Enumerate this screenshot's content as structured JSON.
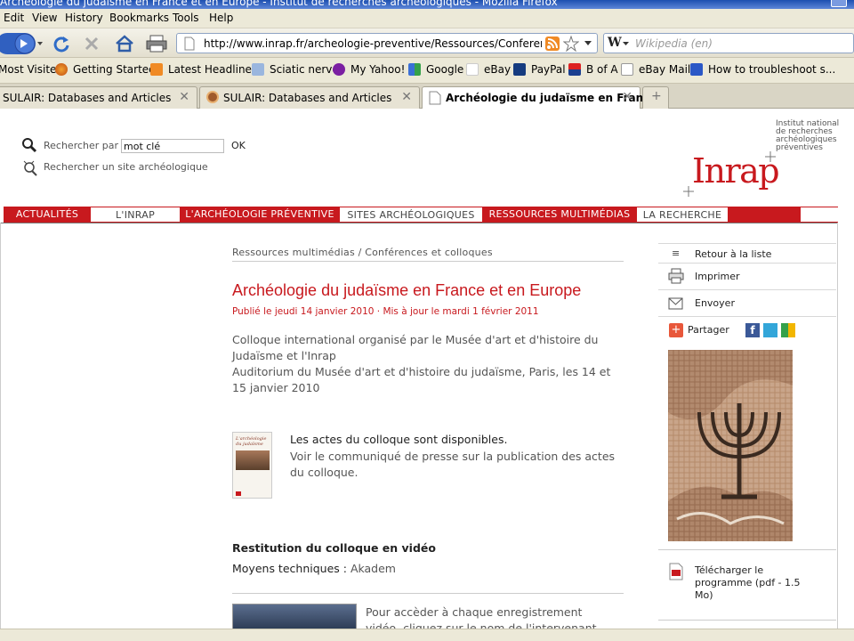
{
  "window": {
    "title": "Archéologie du judaïsme en France et en Europe - Institut de recherches archéologiques - Mozilla Firefox"
  },
  "menu": {
    "items": [
      "Edit",
      "View",
      "History",
      "Bookmarks",
      "Tools",
      "Help"
    ]
  },
  "nav": {
    "url": "http://www.inrap.fr/archeologie-preventive/Ressources/Conferences-et",
    "search_placeholder": "Wikipedia (en)"
  },
  "bookmarks": [
    {
      "label": "Most Visited",
      "icon": "folder-icon"
    },
    {
      "label": "Getting Started",
      "icon": "firefox-icon"
    },
    {
      "label": "Latest Headlines",
      "icon": "rss-icon"
    },
    {
      "label": "Sciatic nerve",
      "icon": "page-icon"
    },
    {
      "label": "My Yahoo!",
      "icon": "yahoo-icon"
    },
    {
      "label": "Google",
      "icon": "google-icon"
    },
    {
      "label": "eBay",
      "icon": "ebay-icon"
    },
    {
      "label": "PayPal",
      "icon": "paypal-icon"
    },
    {
      "label": "B of A",
      "icon": "bofa-icon"
    },
    {
      "label": "eBay Mail",
      "icon": "page-icon"
    },
    {
      "label": "How to troubleshoot s...",
      "icon": "ms-icon"
    }
  ],
  "tabs": [
    {
      "label": "SULAIR: Databases and Articles"
    },
    {
      "label": "SULAIR: Databases and Articles"
    },
    {
      "label": "Archéologie du judaïsme en Franc..."
    }
  ],
  "page": {
    "search_label": "Rechercher par",
    "search_value": "mot clé",
    "search_ok": "OK",
    "search_site": "Rechercher un site archéologique",
    "logo_text": "Inrap",
    "logo_caption": [
      "Institut national",
      "de recherches",
      "archéologiques",
      "préventives"
    ],
    "nav_items": [
      "ACTUALITÉS",
      "L'INRAP",
      "L'ARCHÉOLOGIE PRÉVENTIVE",
      "SITES ARCHÉOLOGIQUES",
      "RESSOURCES MULTIMÉDIAS",
      "LA RECHERCHE"
    ],
    "breadcrumb": "Ressources multimédias / Conférences et colloques",
    "title": "Archéologie du judaïsme en France et en Europe",
    "published": "Publié le jeudi 14 janvier 2010 · Mis à jour le mardi 1 février 2011",
    "intro_1": "Colloque international organisé par le Musée d'art et d'histoire du Judaïsme et l'Inrap",
    "intro_2": "Auditorium du Musée d'art et d'histoire du judaïsme, Paris, les 14 et 15 janvier 2010",
    "actes_1": "Les actes du colloque sont disponibles.",
    "actes_2": "Voir le communiqué de presse sur la publication des actes du colloque.",
    "video_heading": "Restitution du colloque en vidéo",
    "tech_label": "Moyens techniques : ",
    "tech_link": "Akadem",
    "access_text": "Pour accèder à chaque enregistrement vidéo, cliquez sur le nom de l'intervenant",
    "side_return": "Retour à la liste",
    "side_print": "Imprimer",
    "side_send": "Envoyer",
    "side_share": "Partager",
    "side_download": "Télécharger le programme (pdf - 1.5 Mo)"
  },
  "colors": {
    "brand_red": "#c8191e",
    "title_red": "#c8191e"
  }
}
